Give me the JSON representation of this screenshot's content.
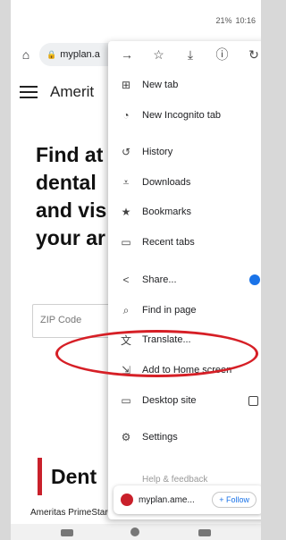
{
  "status": {
    "signal": "🔋",
    "battery": "21%",
    "time": "10:16"
  },
  "address_bar": {
    "url": "myplan.a"
  },
  "page": {
    "brand_partial": "Amerit",
    "headline": [
      "Find at",
      "dental",
      "and vis",
      "your ar"
    ],
    "zip_placeholder": "ZIP Code",
    "section_title": "Dent",
    "footer_text": "Ameritas PrimeStar® dental insurance plans"
  },
  "menu": {
    "toolbar": [
      "forward-icon",
      "star-icon",
      "download-icon",
      "info-icon",
      "refresh-icon"
    ],
    "items": [
      {
        "label": "New tab",
        "icon": "plus-square-icon"
      },
      {
        "label": "New Incognito tab",
        "icon": "incognito-icon"
      },
      {
        "label": "History",
        "icon": "history-icon"
      },
      {
        "label": "Downloads",
        "icon": "downloads-icon"
      },
      {
        "label": "Bookmarks",
        "icon": "star-icon"
      },
      {
        "label": "Recent tabs",
        "icon": "recent-tabs-icon"
      },
      {
        "label": "Share...",
        "icon": "share-icon"
      },
      {
        "label": "Find in page",
        "icon": "find-icon"
      },
      {
        "label": "Translate...",
        "icon": "translate-icon"
      },
      {
        "label": "Add to Home screen",
        "icon": "add-home-icon"
      },
      {
        "label": "Desktop site",
        "icon": "desktop-icon"
      },
      {
        "label": "Settings",
        "icon": "gear-icon"
      }
    ],
    "faded_item": "Help & feedback",
    "follow_card": {
      "site": "myplan.ame...",
      "button": "+ Follow"
    }
  },
  "colors": {
    "accent_red": "#d61f26",
    "brand_red": "#c9202b",
    "chrome_blue": "#1a73e8"
  }
}
